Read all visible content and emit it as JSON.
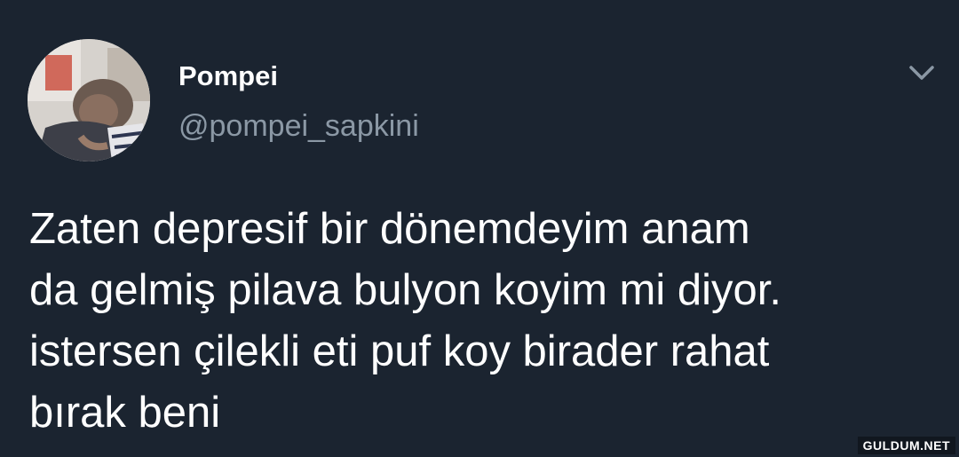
{
  "user": {
    "display_name": "Pompei",
    "handle": "@pompei_sapkini"
  },
  "tweet": {
    "lines": [
      "Zaten depresif bir dönemdeyim anam",
      "da gelmiş pilava bulyon koyim mi diyor.",
      "istersen çilekli eti puf koy birader rahat",
      "bırak beni"
    ]
  },
  "icons": {
    "menu": "chevron-down-icon",
    "avatar": "avatar"
  },
  "watermark": "GULDUM.NET",
  "colors": {
    "background": "#1b2430",
    "text": "#ffffff",
    "secondary_text": "#8b98a5"
  }
}
